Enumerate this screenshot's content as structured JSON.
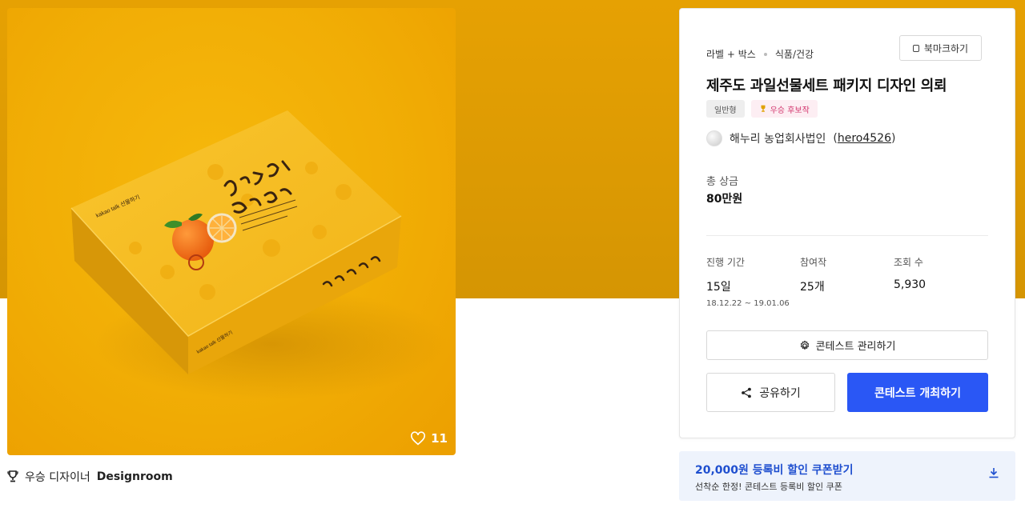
{
  "hero": {
    "likes_count": "11"
  },
  "winner": {
    "prefix": "우승 디자이너",
    "name": "Designroom"
  },
  "panel": {
    "category_primary": "라벨 + 박스",
    "category_secondary": "식품/건강",
    "bookmark_label": "북마크하기",
    "title": "제주도 과일선물세트 패키지 디자인 의뢰",
    "tags": [
      "일반형",
      "우승 후보작"
    ],
    "owner_name": "해누리 농업회사법인",
    "owner_handle": "hero4526",
    "prize_label": "총 상금",
    "prize_value": "80만원",
    "stats": {
      "period_label": "진행 기간",
      "period_value": "15일",
      "period_range": "18.12.22 ~ 19.01.06",
      "entries_label": "참여작",
      "entries_value": "25개",
      "views_label": "조회 수",
      "views_value": "5,930"
    },
    "manage_label": "콘테스트 관리하기",
    "share_label": "공유하기",
    "host_label": "콘테스트 개최하기"
  },
  "coupon": {
    "title": "20,000원 등록비 할인 쿠폰받기",
    "subtitle": "선착순 한정! 콘테스트 등록비 할인 쿠폰"
  },
  "colors": {
    "hero_bg": "#e6a103",
    "image_bg": "#f1ad05",
    "primary_button": "#2a57f5",
    "coupon_bg": "#eef3fc",
    "coupon_text": "#1f4fcf",
    "candidate_tag": "#d2356d"
  },
  "icons": {
    "like": "heart-icon",
    "winner": "trophy-icon",
    "bookmark": "bookmark-icon",
    "manage": "gear-icon",
    "share": "share-icon",
    "coupon": "download-icon"
  }
}
